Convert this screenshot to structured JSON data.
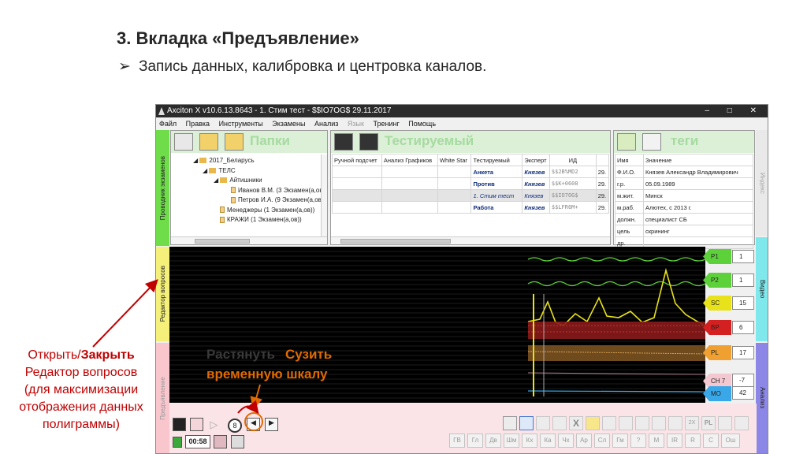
{
  "slide": {
    "title": "3. Вкладка «Предъявление»",
    "bullet_marker": "➢",
    "bullet": "Запись данных, калибровка и центровка каналов."
  },
  "annotation_left": {
    "line1_normal": "Открыть/",
    "line1_bold": "Закрыть",
    "line2": "Редактор вопросов",
    "line3": "(для максимизации",
    "line4": "отображения данных",
    "line5": "полиграммы)"
  },
  "annotation_chart": {
    "ghost": "Растянуть",
    "line1": "Сузить",
    "line2": "временную шкалу"
  },
  "window": {
    "title": "Axciton X v10.6.13.8643 - 1. Стим тест - $$IO7OG$ 29.11.2017",
    "controls": "– □ ✕"
  },
  "menu": [
    "Файл",
    "Правка",
    "Инструменты",
    "Экзамены",
    "Анализ",
    "Язык",
    "Тренинг",
    "Помощь"
  ],
  "side_tabs": {
    "explorer": "Проводник экзаменов",
    "question_editor": "Редактор вопросов",
    "presentation": "Предъявление",
    "index": "Индекс",
    "video": "Видео",
    "analysis": "Анализ"
  },
  "folders_pane": {
    "title": "Папки",
    "tree": [
      {
        "label": "2017_Беларусь",
        "level": 0
      },
      {
        "label": "ТЕЛС",
        "level": 1
      },
      {
        "label": "Айтишники",
        "level": 2
      },
      {
        "label": "Иванов В.М. (3 Экзамен(а,ов))",
        "level": 3
      },
      {
        "label": "Петров И.А. (9 Экзамен(а,ов))",
        "level": 3
      },
      {
        "label": "Менеджеры (1 Экзамен(а,ов))",
        "level": 2
      },
      {
        "label": "КРАЖИ (1 Экзамен(а,ов))",
        "level": 2
      }
    ]
  },
  "subject_pane": {
    "title": "Тестируемый",
    "columns_left": [
      "Ручной подсчет",
      "Анализ Графиков",
      "White Star"
    ],
    "columns": [
      "Тестируемый",
      "Эксперт",
      "ИД",
      ""
    ],
    "rows": [
      {
        "name": "Анкета",
        "expert": "Князев",
        "id": "$$2B%MD2",
        "date": "29.",
        "style": "bold"
      },
      {
        "name": "Против",
        "expert": "Князев",
        "id": "$$K+0608",
        "date": "29.",
        "style": "bold"
      },
      {
        "name": "1. Стим тест",
        "expert": "Князев",
        "id": "$$IO7OG$",
        "date": "29.",
        "style": "italic"
      },
      {
        "name": "Работа",
        "expert": "Князев",
        "id": "$$LFR6M+",
        "date": "29.",
        "style": "bold"
      }
    ]
  },
  "tags_pane": {
    "title": "теги",
    "columns": [
      "Имя",
      "Значение"
    ],
    "rows": [
      {
        "k": "Ф.И.О.",
        "v": "Князев Александр Владимирович"
      },
      {
        "k": "г.р.",
        "v": "05.09.1989"
      },
      {
        "k": "м.жит.",
        "v": "Минск"
      },
      {
        "k": "м.раб.",
        "v": "Алютех, с 2013 г."
      },
      {
        "k": "должн.",
        "v": "специалист СБ"
      },
      {
        "k": "цель",
        "v": "скрининг"
      },
      {
        "k": "др.",
        "v": ""
      }
    ]
  },
  "channels": [
    {
      "name": "P1",
      "value": "1",
      "color": "#5cd13a"
    },
    {
      "name": "P2",
      "value": "1",
      "color": "#5cd13a"
    },
    {
      "name": "SC",
      "value": "15",
      "color": "#e8e21a"
    },
    {
      "name": "BP",
      "value": "6",
      "color": "#d42020"
    },
    {
      "name": "PL",
      "value": "17",
      "color": "#f0a030"
    },
    {
      "name": "CH 7",
      "value": "-7",
      "color": "#f4c8d0"
    },
    {
      "name": "MO",
      "value": "42",
      "color": "#3aa8e8"
    }
  ],
  "bottom": {
    "zoom_value": "8",
    "timer": "00:58",
    "letter_buttons": [
      "ГВ",
      "Гл",
      "Дв",
      "Шм",
      "Кх",
      "Ка",
      "Чх",
      "Ар",
      "Сл",
      "Гм",
      "?",
      "М",
      "IR",
      "R",
      "С",
      "Ош"
    ],
    "tool_labels": [
      "X",
      "2X",
      "PL"
    ]
  },
  "colors": {
    "annotation_red": "#c00000",
    "annotation_orange": "#e06b00",
    "pane_green": "#a6dba0"
  }
}
